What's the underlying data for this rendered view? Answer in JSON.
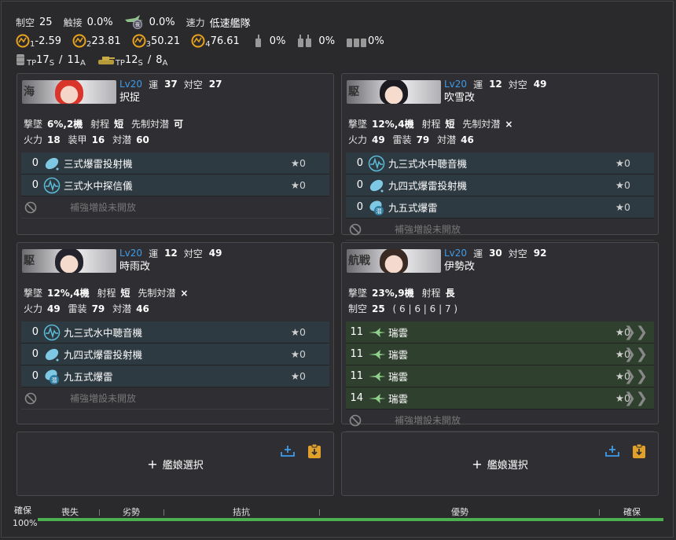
{
  "header": {
    "air_control_label": "制空",
    "air_control_value": "25",
    "contact_label": "触接",
    "contact_value": "0.0%",
    "night_contact_value": "0.0%",
    "speed_label": "速力",
    "speed_value": "低速艦隊",
    "los": [
      {
        "sub": "1",
        "value": "-2.59"
      },
      {
        "sub": "2",
        "value": "23.81"
      },
      {
        "sub": "3",
        "value": "50.21"
      },
      {
        "sub": "4",
        "value": "76.61"
      }
    ],
    "drum_rates": [
      "0%",
      "0%",
      "0%"
    ],
    "tp_drum_prefix": "TP",
    "tp_drum_s": "17",
    "tp_drum_a": "11",
    "tp_tank_prefix": "TP",
    "tp_tank_s": "12",
    "tp_tank_a": "8",
    "s_sub": "S",
    "a_sub": "A",
    "slash": "/"
  },
  "colors": {
    "accent": "#3d9be9",
    "sonar": "#5bbbd8",
    "green_bar": "#4caf50"
  },
  "ships": [
    {
      "lv": "Lv20",
      "luck_label": "運",
      "luck": "37",
      "aa_label": "対空",
      "aa": "27",
      "name": "択捉",
      "row2": [
        {
          "k": "撃墜",
          "v": "6%,2機"
        },
        {
          "k": "射程",
          "v": "短"
        },
        {
          "k": "先制対潜",
          "v": "可"
        }
      ],
      "row3": [
        {
          "k": "火力",
          "v": "18"
        },
        {
          "k": "装甲",
          "v": "16"
        },
        {
          "k": "対潜",
          "v": "60"
        }
      ],
      "equip": [
        {
          "count": "0",
          "name": "三式爆雷投射機",
          "star": "★0",
          "icon": "depth-charge-projector-icon"
        },
        {
          "count": "0",
          "name": "三式水中探信儀",
          "star": "★0",
          "icon": "sonar-icon"
        }
      ],
      "ex_label": "補強増設未開放"
    },
    {
      "lv": "Lv20",
      "luck_label": "運",
      "luck": "12",
      "aa_label": "対空",
      "aa": "49",
      "name": "吹雪改",
      "row2": [
        {
          "k": "撃墜",
          "v": "12%,4機"
        },
        {
          "k": "射程",
          "v": "短"
        },
        {
          "k": "先制対潜",
          "v": "×"
        }
      ],
      "row3": [
        {
          "k": "火力",
          "v": "49"
        },
        {
          "k": "雷装",
          "v": "79"
        },
        {
          "k": "対潜",
          "v": "46"
        }
      ],
      "equip": [
        {
          "count": "0",
          "name": "九三式水中聴音機",
          "star": "★0",
          "icon": "sonar-icon"
        },
        {
          "count": "0",
          "name": "九四式爆雷投射機",
          "star": "★0",
          "icon": "depth-charge-projector-icon"
        },
        {
          "count": "0",
          "name": "九五式爆雷",
          "star": "★0",
          "icon": "depth-charge-icon"
        }
      ],
      "ex_label": "補強増設未開放"
    },
    {
      "lv": "Lv20",
      "luck_label": "運",
      "luck": "12",
      "aa_label": "対空",
      "aa": "49",
      "name": "時雨改",
      "row2": [
        {
          "k": "撃墜",
          "v": "12%,4機"
        },
        {
          "k": "射程",
          "v": "短"
        },
        {
          "k": "先制対潜",
          "v": "×"
        }
      ],
      "row3": [
        {
          "k": "火力",
          "v": "49"
        },
        {
          "k": "雷装",
          "v": "79"
        },
        {
          "k": "対潜",
          "v": "46"
        }
      ],
      "equip": [
        {
          "count": "0",
          "name": "九三式水中聴音機",
          "star": "★0",
          "icon": "sonar-icon"
        },
        {
          "count": "0",
          "name": "九四式爆雷投射機",
          "star": "★0",
          "icon": "depth-charge-projector-icon"
        },
        {
          "count": "0",
          "name": "九五式爆雷",
          "star": "★0",
          "icon": "depth-charge-icon"
        }
      ],
      "ex_label": "補強増設未開放"
    },
    {
      "lv": "Lv20",
      "luck_label": "運",
      "luck": "30",
      "aa_label": "対空",
      "aa": "92",
      "name": "伊勢改",
      "row2": [
        {
          "k": "撃墜",
          "v": "23%,9機"
        },
        {
          "k": "射程",
          "v": "長"
        }
      ],
      "row3_air_label": "制空",
      "row3_air_value": "25",
      "row3_air_detail": "( 6 | 6 | 6 | 7 )",
      "equip": [
        {
          "count": "11",
          "name": "瑞雲",
          "star": "★0",
          "icon": "seaplane-bomber-icon"
        },
        {
          "count": "11",
          "name": "瑞雲",
          "star": "★0",
          "icon": "seaplane-bomber-icon"
        },
        {
          "count": "11",
          "name": "瑞雲",
          "star": "★0",
          "icon": "seaplane-bomber-icon"
        },
        {
          "count": "14",
          "name": "瑞雲",
          "star": "★0",
          "icon": "seaplane-bomber-icon"
        }
      ],
      "ex_label": "補強増設未開放"
    }
  ],
  "add_slots": [
    {
      "label": "艦娘選択"
    },
    {
      "label": "艦娘選択"
    }
  ],
  "air_state": {
    "left_label": "確保",
    "percent": "100%",
    "labels": [
      "喪失",
      "劣勢",
      "拮抗",
      "優勢",
      "確保"
    ]
  }
}
